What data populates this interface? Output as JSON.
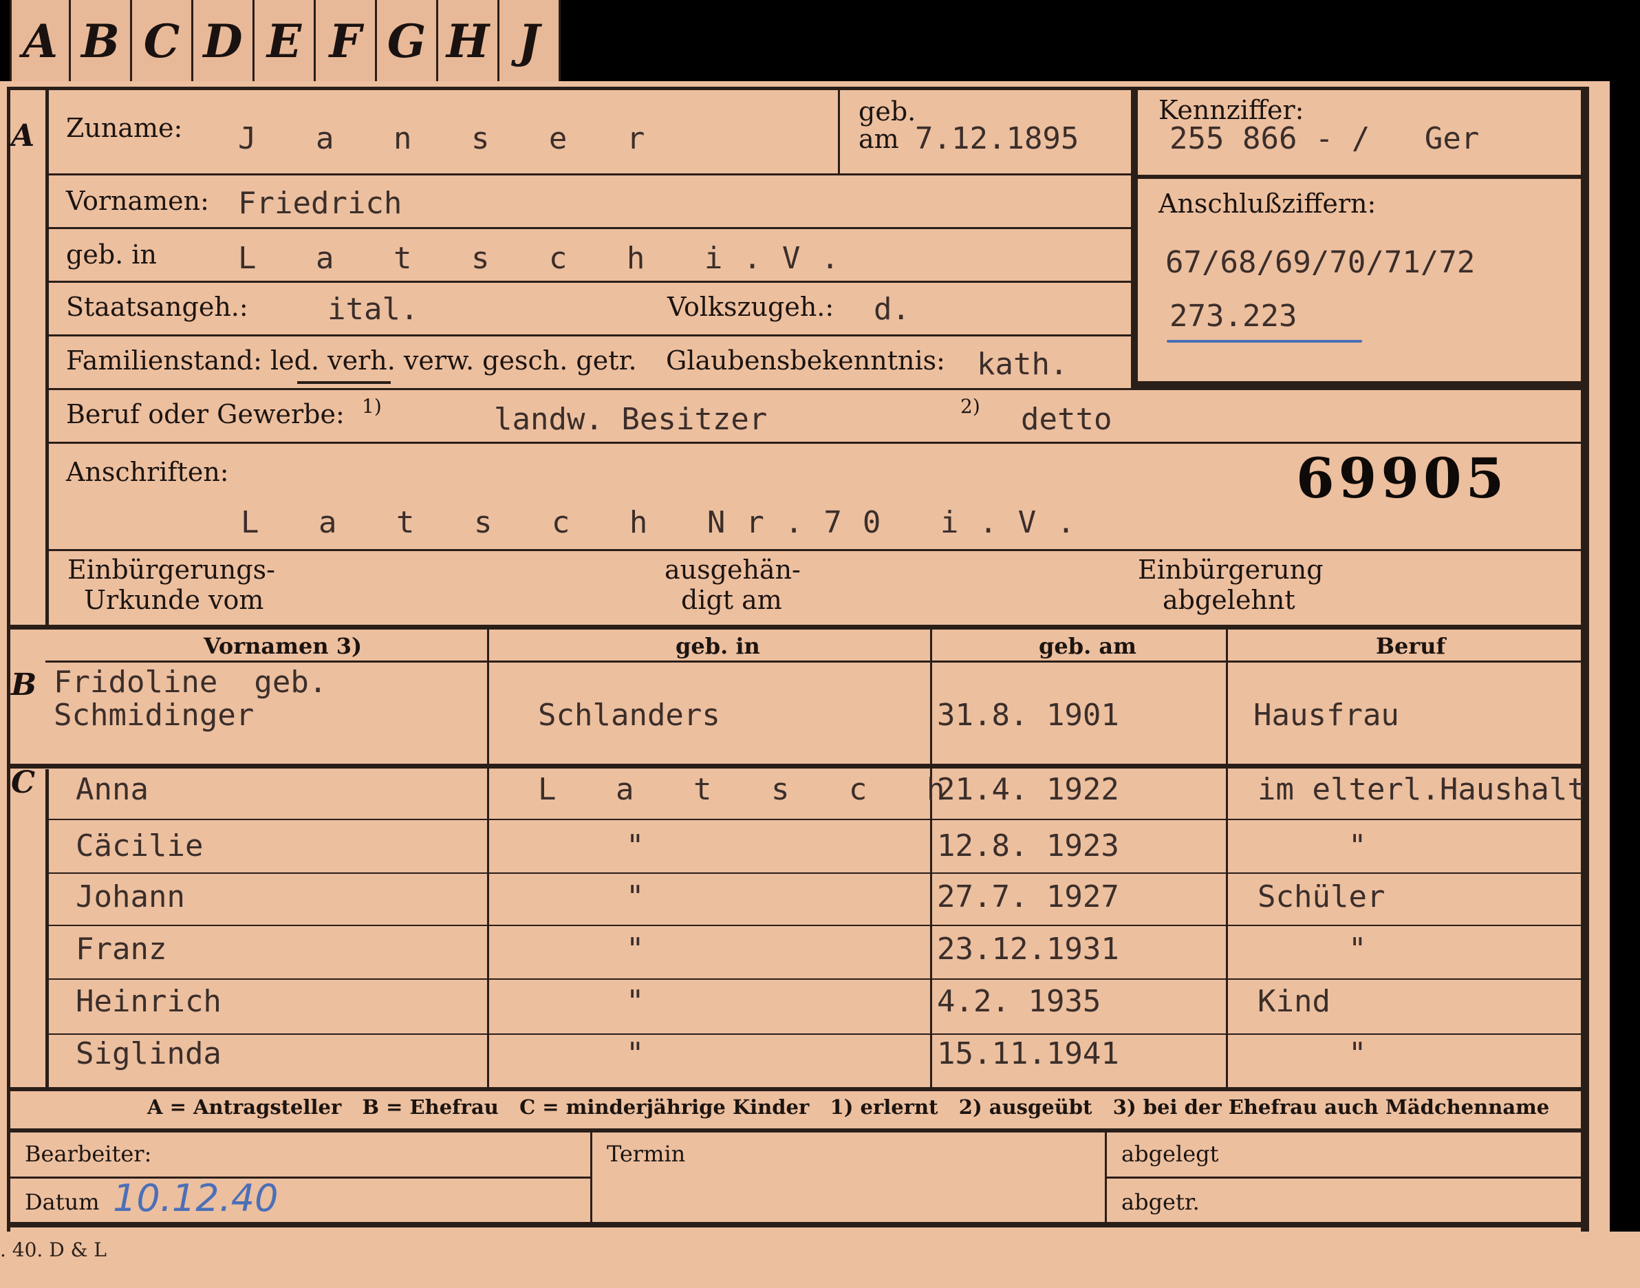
{
  "tabs": [
    "A",
    "B",
    "C",
    "D",
    "E",
    "F",
    "G",
    "H",
    "J"
  ],
  "sections": {
    "a": "A",
    "b": "B",
    "c": "C"
  },
  "applicant": {
    "surname_label": "Zuname:",
    "surname": "J a n s e r",
    "birth_label_1": "geb.",
    "birth_label_2": "am",
    "birth_date": "7.12.1895",
    "kennziffer_label": "Kennziffer:",
    "kennziffer": "255 866 - /   Ger",
    "vornamen_label": "Vornamen:",
    "vornamen": "Friedrich",
    "anschluss_label": "Anschlußziffern:",
    "anschluss_1": "67/68/69/70/71/72",
    "anschluss_2": "273.223",
    "geb_in_label": "geb. in",
    "geb_in": "L a t s c h i.V.",
    "staat_label": "Staatsangeh.:",
    "staat": "ital.",
    "volk_label": "Volkszugeh.:",
    "volk": "d.",
    "familie_label": "Familienstand: led. verh. verw. gesch. getr.",
    "glaube_label": "Glaubensbekenntnis:",
    "glaube": "kath.",
    "beruf_label": "Beruf oder Gewerbe:",
    "beruf_mark1": "1)",
    "beruf1": "landw. Besitzer",
    "beruf_mark2": "2)",
    "beruf2": "detto",
    "anschriften_label": "Anschriften:",
    "anschrift": "L a t s c h Nr.70 i.V.",
    "number": "69905",
    "einb_label_1": "Einbürgerungs-",
    "einb_label_2": "Urkunde vom",
    "ausg_label_1": "ausgehän-",
    "ausg_label_2": "digt am",
    "abgel_label_1": "Einbürgerung",
    "abgel_label_2": "abgelehnt"
  },
  "columns": {
    "vornamen": "Vornamen 3)",
    "geb_in": "geb. in",
    "geb_am": "geb. am",
    "beruf": "Beruf"
  },
  "spouse": {
    "name_1": "Fridoline  geb.",
    "name_2": "Schmidinger",
    "place": "Schlanders",
    "date": "31.8. 1901",
    "job": "Hausfrau"
  },
  "children": [
    {
      "name": "Anna",
      "place": "L a t s c h",
      "date": "21.4. 1922",
      "job": "im elterl.Haushalt"
    },
    {
      "name": "Cäcilie",
      "place": "\"",
      "date": "12.8. 1923",
      "job": "\""
    },
    {
      "name": "Johann",
      "place": "\"",
      "date": "27.7. 1927",
      "job": "Schüler"
    },
    {
      "name": "Franz",
      "place": "\"",
      "date": "23.12.1931",
      "job": "\""
    },
    {
      "name": "Heinrich",
      "place": "\"",
      "date": "4.2. 1935",
      "job": "Kind"
    },
    {
      "name": "Siglinda",
      "place": "\"",
      "date": "15.11.1941",
      "job": "\""
    }
  ],
  "legend": "A = Antragsteller   B = Ehefrau   C = minderjährige Kinder   1) erlernt   2) ausgeübt   3) bei der Ehefrau auch Mädchenname",
  "footer": {
    "bearbeiter_label": "Bearbeiter:",
    "termin_label": "Termin",
    "abgelegt_label": "abgelegt",
    "datum_label": "Datum",
    "datum": "10.12.40",
    "abgetr_label": "abgetr.",
    "print_code": ". 40. D & L"
  },
  "colors": {
    "card": "#ecbf9f",
    "ink": "#1c1410",
    "type": "#3b2e2a",
    "pencil_blue": "#4b6fb8"
  }
}
